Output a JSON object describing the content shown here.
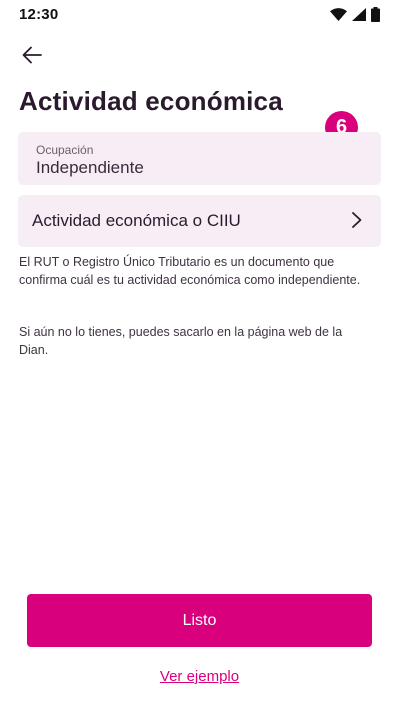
{
  "status_bar": {
    "time": "12:30",
    "icons": [
      "wifi-icon",
      "signal-icon",
      "battery-icon"
    ]
  },
  "header": {
    "back_icon": "arrow-left-icon",
    "title": "Actividad económica",
    "step_number": "6"
  },
  "form": {
    "occupation": {
      "label": "Ocupación",
      "value": "Independiente"
    },
    "activity": {
      "label": "Actividad económica o CIIU",
      "icon": "chevron-right-icon"
    }
  },
  "help": {
    "paragraph_1": "El RUT o Registro Único Tributario es un documento que confirma cuál es tu actividad económica como independiente.",
    "paragraph_2": "Si aún no lo tienes, puedes sacarlo en la página web de la Dian."
  },
  "actions": {
    "primary_label": "Listo",
    "secondary_label": "Ver ejemplo"
  },
  "colors": {
    "accent": "#d9007e",
    "field_background": "#f6eef4",
    "text": "#2b1a2e"
  }
}
